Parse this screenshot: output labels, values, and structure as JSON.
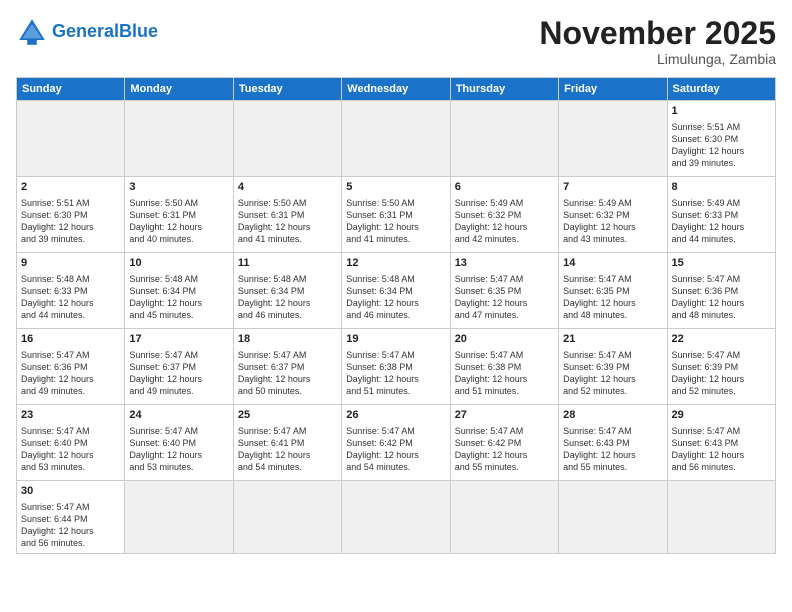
{
  "header": {
    "logo_general": "General",
    "logo_blue": "Blue",
    "month_title": "November 2025",
    "location": "Limulunga, Zambia"
  },
  "weekdays": [
    "Sunday",
    "Monday",
    "Tuesday",
    "Wednesday",
    "Thursday",
    "Friday",
    "Saturday"
  ],
  "weeks": [
    [
      {
        "day": "",
        "info": "",
        "empty": true
      },
      {
        "day": "",
        "info": "",
        "empty": true
      },
      {
        "day": "",
        "info": "",
        "empty": true
      },
      {
        "day": "",
        "info": "",
        "empty": true
      },
      {
        "day": "",
        "info": "",
        "empty": true
      },
      {
        "day": "",
        "info": "",
        "empty": true
      },
      {
        "day": "1",
        "info": "Sunrise: 5:51 AM\nSunset: 6:30 PM\nDaylight: 12 hours\nand 39 minutes."
      }
    ],
    [
      {
        "day": "2",
        "info": "Sunrise: 5:51 AM\nSunset: 6:30 PM\nDaylight: 12 hours\nand 39 minutes."
      },
      {
        "day": "3",
        "info": "Sunrise: 5:50 AM\nSunset: 6:31 PM\nDaylight: 12 hours\nand 40 minutes."
      },
      {
        "day": "4",
        "info": "Sunrise: 5:50 AM\nSunset: 6:31 PM\nDaylight: 12 hours\nand 41 minutes."
      },
      {
        "day": "5",
        "info": "Sunrise: 5:50 AM\nSunset: 6:31 PM\nDaylight: 12 hours\nand 41 minutes."
      },
      {
        "day": "6",
        "info": "Sunrise: 5:49 AM\nSunset: 6:32 PM\nDaylight: 12 hours\nand 42 minutes."
      },
      {
        "day": "7",
        "info": "Sunrise: 5:49 AM\nSunset: 6:32 PM\nDaylight: 12 hours\nand 43 minutes."
      },
      {
        "day": "8",
        "info": "Sunrise: 5:49 AM\nSunset: 6:33 PM\nDaylight: 12 hours\nand 44 minutes."
      }
    ],
    [
      {
        "day": "9",
        "info": "Sunrise: 5:48 AM\nSunset: 6:33 PM\nDaylight: 12 hours\nand 44 minutes."
      },
      {
        "day": "10",
        "info": "Sunrise: 5:48 AM\nSunset: 6:34 PM\nDaylight: 12 hours\nand 45 minutes."
      },
      {
        "day": "11",
        "info": "Sunrise: 5:48 AM\nSunset: 6:34 PM\nDaylight: 12 hours\nand 46 minutes."
      },
      {
        "day": "12",
        "info": "Sunrise: 5:48 AM\nSunset: 6:34 PM\nDaylight: 12 hours\nand 46 minutes."
      },
      {
        "day": "13",
        "info": "Sunrise: 5:47 AM\nSunset: 6:35 PM\nDaylight: 12 hours\nand 47 minutes."
      },
      {
        "day": "14",
        "info": "Sunrise: 5:47 AM\nSunset: 6:35 PM\nDaylight: 12 hours\nand 48 minutes."
      },
      {
        "day": "15",
        "info": "Sunrise: 5:47 AM\nSunset: 6:36 PM\nDaylight: 12 hours\nand 48 minutes."
      }
    ],
    [
      {
        "day": "16",
        "info": "Sunrise: 5:47 AM\nSunset: 6:36 PM\nDaylight: 12 hours\nand 49 minutes."
      },
      {
        "day": "17",
        "info": "Sunrise: 5:47 AM\nSunset: 6:37 PM\nDaylight: 12 hours\nand 49 minutes."
      },
      {
        "day": "18",
        "info": "Sunrise: 5:47 AM\nSunset: 6:37 PM\nDaylight: 12 hours\nand 50 minutes."
      },
      {
        "day": "19",
        "info": "Sunrise: 5:47 AM\nSunset: 6:38 PM\nDaylight: 12 hours\nand 51 minutes."
      },
      {
        "day": "20",
        "info": "Sunrise: 5:47 AM\nSunset: 6:38 PM\nDaylight: 12 hours\nand 51 minutes."
      },
      {
        "day": "21",
        "info": "Sunrise: 5:47 AM\nSunset: 6:39 PM\nDaylight: 12 hours\nand 52 minutes."
      },
      {
        "day": "22",
        "info": "Sunrise: 5:47 AM\nSunset: 6:39 PM\nDaylight: 12 hours\nand 52 minutes."
      }
    ],
    [
      {
        "day": "23",
        "info": "Sunrise: 5:47 AM\nSunset: 6:40 PM\nDaylight: 12 hours\nand 53 minutes."
      },
      {
        "day": "24",
        "info": "Sunrise: 5:47 AM\nSunset: 6:40 PM\nDaylight: 12 hours\nand 53 minutes."
      },
      {
        "day": "25",
        "info": "Sunrise: 5:47 AM\nSunset: 6:41 PM\nDaylight: 12 hours\nand 54 minutes."
      },
      {
        "day": "26",
        "info": "Sunrise: 5:47 AM\nSunset: 6:42 PM\nDaylight: 12 hours\nand 54 minutes."
      },
      {
        "day": "27",
        "info": "Sunrise: 5:47 AM\nSunset: 6:42 PM\nDaylight: 12 hours\nand 55 minutes."
      },
      {
        "day": "28",
        "info": "Sunrise: 5:47 AM\nSunset: 6:43 PM\nDaylight: 12 hours\nand 55 minutes."
      },
      {
        "day": "29",
        "info": "Sunrise: 5:47 AM\nSunset: 6:43 PM\nDaylight: 12 hours\nand 56 minutes."
      }
    ],
    [
      {
        "day": "30",
        "info": "Sunrise: 5:47 AM\nSunset: 6:44 PM\nDaylight: 12 hours\nand 56 minutes."
      },
      {
        "day": "",
        "info": "",
        "empty": true
      },
      {
        "day": "",
        "info": "",
        "empty": true
      },
      {
        "day": "",
        "info": "",
        "empty": true
      },
      {
        "day": "",
        "info": "",
        "empty": true
      },
      {
        "day": "",
        "info": "",
        "empty": true
      },
      {
        "day": "",
        "info": "",
        "empty": true
      }
    ]
  ]
}
